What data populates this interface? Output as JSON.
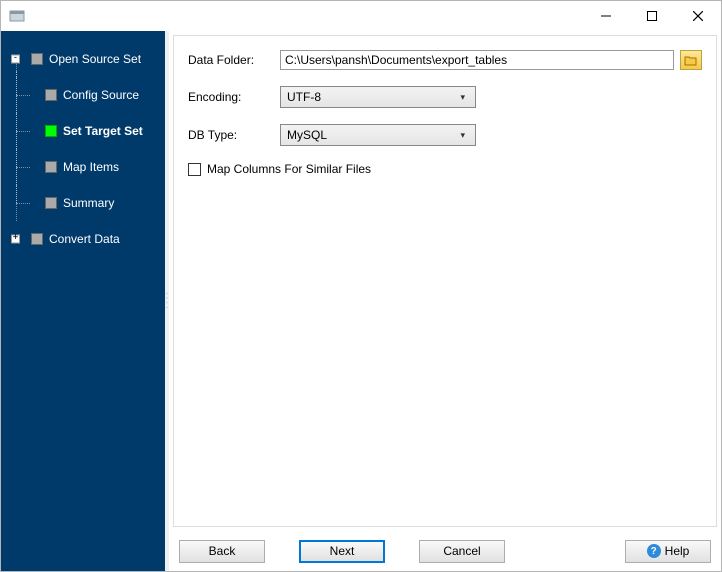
{
  "titlebar": {
    "title": ""
  },
  "sidebar": {
    "top1": "Open Source Set",
    "children1": [
      {
        "label": "Config Source"
      },
      {
        "label": "Set Target Set",
        "active": true
      },
      {
        "label": "Map Items"
      },
      {
        "label": "Summary"
      }
    ],
    "top2": "Convert Data"
  },
  "form": {
    "dataFolderLabel": "Data Folder:",
    "dataFolderValue": "C:\\Users\\pansh\\Documents\\export_tables",
    "encodingLabel": "Encoding:",
    "encodingValue": "UTF-8",
    "dbTypeLabel": "DB Type:",
    "dbTypeValue": "MySQL",
    "mapColumnsLabel": "Map Columns For Similar Files"
  },
  "buttons": {
    "back": "Back",
    "next": "Next",
    "cancel": "Cancel",
    "help": "Help"
  }
}
